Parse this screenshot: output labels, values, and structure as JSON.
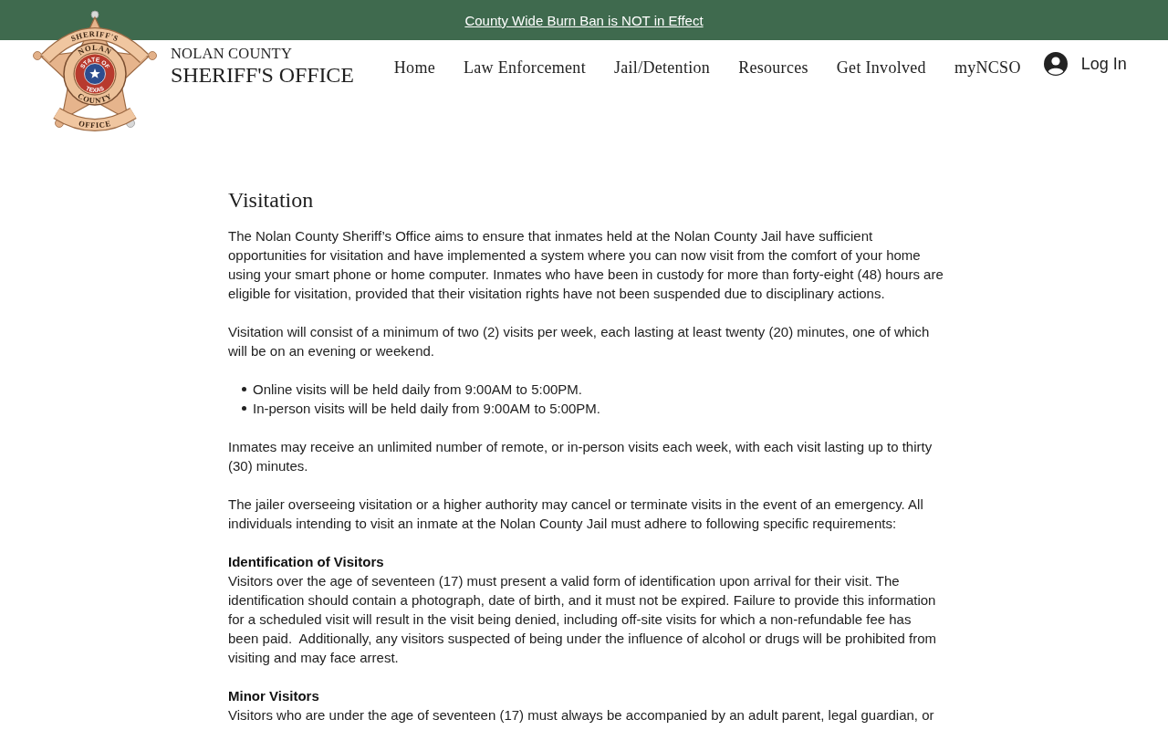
{
  "banner": {
    "link": "County Wide Burn Ban is NOT in Effect"
  },
  "header": {
    "logo": {
      "ribbon_top": "SHERIFF'S",
      "ring_top": "NOLAN",
      "ring_bottom": "COUNTY",
      "seal_top": "STATE OF",
      "seal_bottom": "TEXAS",
      "ribbon_bottom": "OFFICE"
    },
    "brand": {
      "line_1": "NOLAN COUNTY",
      "line_2": "SHERIFF'S OFFICE"
    },
    "nav": [
      {
        "label": "Home"
      },
      {
        "label": "Law Enforcement"
      },
      {
        "label": "Jail/Detention"
      },
      {
        "label": "Resources"
      },
      {
        "label": "Get Involved"
      },
      {
        "label": "myNCSO"
      }
    ],
    "login": {
      "label": "Log In"
    }
  },
  "content": {
    "title": "Visitation",
    "blocks": [
      {
        "kind": "paragraph",
        "text": "The Nolan County Sheriff’s Office aims to ensure that inmates held at the Nolan County Jail have sufficient opportunities for visitation and have implemented a system where you can now visit from the comfort of your home using your smart phone or home computer. Inmates who have been in custody for more than forty-eight (48) hours are eligible for visitation, provided that their visitation rights have not been suspended due to disciplinary actions."
      },
      {
        "kind": "paragraph",
        "text": "Visitation will consist of a minimum of two (2) visits per week, each lasting at least twenty (20) minutes, one of which will be on an evening or weekend."
      },
      {
        "kind": "list",
        "items": [
          "Online visits will be held daily from 9:00AM to 5:00PM.",
          "In-person visits will be held daily from 9:00AM to 5:00PM."
        ]
      },
      {
        "kind": "paragraph",
        "text": "Inmates may receive an unlimited number of remote, or in-person visits each week, with each visit lasting up to thirty (30) minutes."
      },
      {
        "kind": "paragraph",
        "text": "The jailer overseeing visitation or a higher authority may cancel or terminate visits in the event of an emergency. All individuals intending to visit an inmate at the Nolan County Jail must adhere to following specific requirements:"
      },
      {
        "kind": "section",
        "heading": "Identification of Visitors",
        "text": "Visitors over the age of seventeen (17) must present a valid form of identification upon arrival for their visit. The identification should contain a photograph, date of birth, and it must not be expired. Failure to provide this information for a scheduled visit will result in the visit being denied, including off-site visits for which a non-refundable fee has been paid.  Additionally, any visitors suspected of being under the influence of alcohol or drugs will be prohibited from visiting and may face arrest."
      },
      {
        "kind": "section",
        "heading": "Minor Visitors",
        "text": "Visitors who are under the age of seventeen (17) must always be accompanied by an adult parent, legal guardian, or"
      }
    ]
  }
}
